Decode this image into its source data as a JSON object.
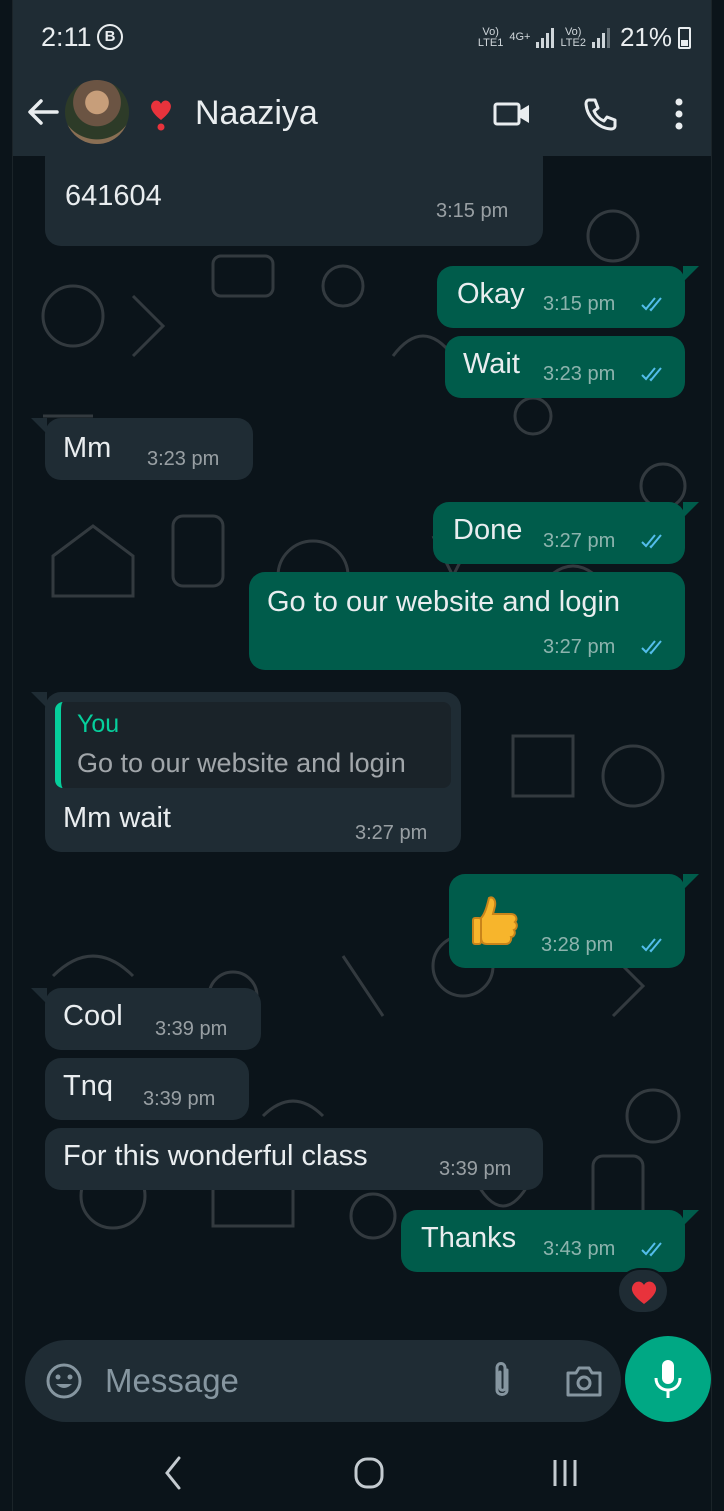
{
  "status_bar": {
    "time": "2:11",
    "badge": "B",
    "net1_top": "Vo)",
    "net1_bottom": "LTE1",
    "net_type": "4G+",
    "net2_top": "Vo)",
    "net2_bottom": "LTE2",
    "battery": "21%"
  },
  "header": {
    "contact_name": "Naaziya",
    "icons": [
      "back-arrow-icon",
      "video-call-icon",
      "voice-call-icon",
      "more-options-icon"
    ]
  },
  "messages": [
    {
      "direction": "incoming",
      "text": "641604",
      "time": "3:15 pm"
    },
    {
      "direction": "outgoing",
      "text": "Okay",
      "time": "3:15 pm",
      "status": "read"
    },
    {
      "direction": "outgoing",
      "text": "Wait",
      "time": "3:23 pm",
      "status": "read"
    },
    {
      "direction": "incoming",
      "text": "Mm",
      "time": "3:23 pm"
    },
    {
      "direction": "outgoing",
      "text": "Done",
      "time": "3:27 pm",
      "status": "read"
    },
    {
      "direction": "outgoing",
      "text": "Go to our website and login",
      "time": "3:27 pm",
      "status": "read"
    },
    {
      "direction": "incoming",
      "quote_author": "You",
      "quote_text": "Go to our website and login",
      "text": "Mm wait",
      "time": "3:27 pm"
    },
    {
      "direction": "outgoing",
      "text": "thumbs-up emoji",
      "time": "3:28 pm",
      "status": "read"
    },
    {
      "direction": "incoming",
      "text": "Cool",
      "time": "3:39 pm"
    },
    {
      "direction": "incoming",
      "text": "Tnq",
      "time": "3:39 pm"
    },
    {
      "direction": "incoming",
      "text": "For this wonderful class",
      "time": "3:39 pm"
    },
    {
      "direction": "outgoing",
      "text": "Thanks",
      "time": "3:43 pm",
      "status": "read",
      "reaction": "heart"
    }
  ],
  "composer": {
    "placeholder": "Message"
  },
  "colors": {
    "background": "#0b141a",
    "bar": "#1f2c34",
    "outgoing_bubble": "#005c4b",
    "incoming_bubble": "#1f2c34",
    "accent": "#00a884",
    "read_ticks": "#53bdeb",
    "quote_bar": "#06cf9c"
  }
}
